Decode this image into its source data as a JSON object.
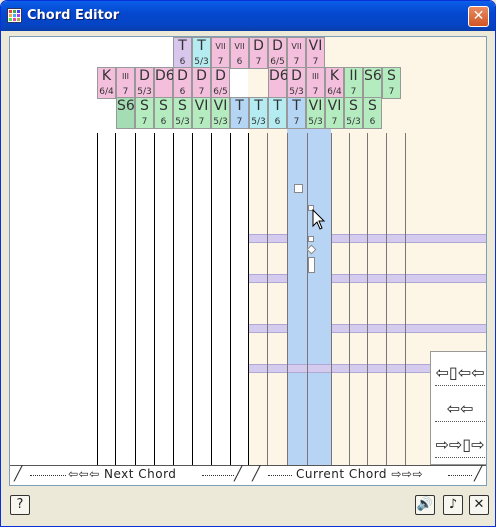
{
  "window": {
    "title": "Chord Editor",
    "close_label": "✕"
  },
  "colors": {
    "pink": "#f4bfdc",
    "purple": "#d9c6ec",
    "cyan": "#b4ecf2",
    "green": "#b4ecc0",
    "blue": "#b4d6f4",
    "current": "#b8d4f4",
    "band": "#d4cbee"
  },
  "chord_rows": {
    "row1": [
      {
        "fn": "T",
        "fig": "6",
        "color": "purple"
      },
      {
        "fn": "T",
        "fig": "5/3",
        "color": "cyan"
      },
      {
        "fn": "VII",
        "fig": "7",
        "color": "pink"
      },
      {
        "fn": "VII",
        "fig": "6",
        "color": "pink"
      },
      {
        "fn": "D",
        "fig": "7",
        "color": "pink"
      },
      {
        "fn": "D",
        "fig": "6/5",
        "color": "pink"
      },
      {
        "fn": "VII",
        "fig": "7",
        "color": "pink"
      },
      {
        "fn": "VI",
        "fig": "7",
        "color": "pink"
      }
    ],
    "row2": [
      {
        "fn": "K",
        "fig": "6/4",
        "color": "pink"
      },
      {
        "fn": "III",
        "fig": "7",
        "color": "pink"
      },
      {
        "fn": "D",
        "fig": "5/3",
        "color": "pink"
      },
      {
        "fn": "D6",
        "fig": "",
        "color": "pink"
      },
      {
        "fn": "D",
        "fig": "6",
        "color": "pink"
      },
      {
        "fn": "D",
        "fig": "7",
        "color": "pink"
      },
      {
        "fn": "D",
        "fig": "6/5",
        "color": "pink"
      },
      {
        "fn": "D6",
        "fig": "",
        "color": "pink"
      },
      {
        "fn": "D",
        "fig": "5/3",
        "color": "pink"
      },
      {
        "fn": "III",
        "fig": "7",
        "color": "pink"
      },
      {
        "fn": "K",
        "fig": "6/4",
        "color": "pink"
      },
      {
        "fn": "II",
        "fig": "7",
        "color": "green"
      },
      {
        "fn": "S6",
        "fig": "",
        "color": "green"
      },
      {
        "fn": "S",
        "fig": "7",
        "color": "green"
      }
    ],
    "row3": [
      {
        "fn": "S6",
        "fig": "",
        "color": "green2"
      },
      {
        "fn": "S",
        "fig": "7",
        "color": "green"
      },
      {
        "fn": "S",
        "fig": "6",
        "color": "green"
      },
      {
        "fn": "S",
        "fig": "5/3",
        "color": "green"
      },
      {
        "fn": "VI",
        "fig": "7",
        "color": "green"
      },
      {
        "fn": "VI",
        "fig": "5/3",
        "color": "green"
      },
      {
        "fn": "T",
        "fig": "7",
        "color": "blue"
      },
      {
        "fn": "T",
        "fig": "5/3",
        "color": "cyan"
      },
      {
        "fn": "T",
        "fig": "6",
        "color": "cyan"
      },
      {
        "fn": "T",
        "fig": "7",
        "color": "blue"
      },
      {
        "fn": "VI",
        "fig": "5/3",
        "color": "green"
      },
      {
        "fn": "VI",
        "fig": "7",
        "color": "green"
      },
      {
        "fn": "S",
        "fig": "5/3",
        "color": "green"
      },
      {
        "fn": "S",
        "fig": "6",
        "color": "green"
      }
    ]
  },
  "nav": {
    "prev_label": "⇦⇦⇦ Next Chord",
    "current_label": "Current Chord ⇨⇨⇨",
    "btn_first": "⇦▯⇦⇦",
    "btn_prev": "⇦⇦",
    "btn_next": "⇨⇨▯⇨"
  },
  "toolbar": {
    "help_label": "?",
    "play_label": "🔊",
    "note_label": "♪",
    "close_label": "✕"
  }
}
